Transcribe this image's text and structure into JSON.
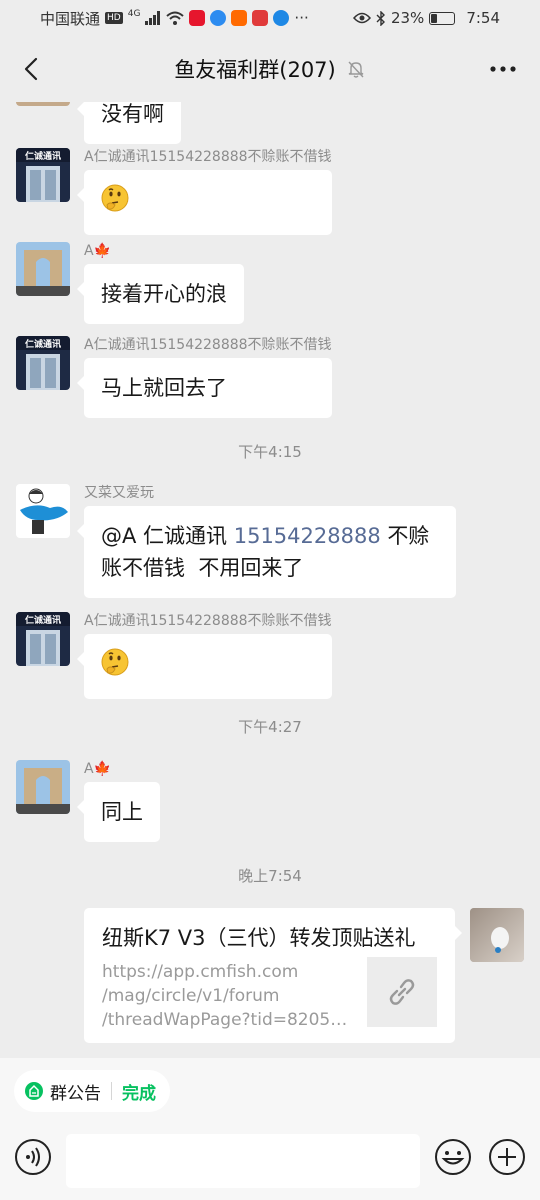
{
  "status_bar": {
    "carrier": "中国联通",
    "network_badge": "HD",
    "network_type": "4G",
    "battery": "23%",
    "battery_level": 0.23,
    "time": "7:54"
  },
  "header": {
    "title": "鱼友福利群(207)"
  },
  "messages": [
    {
      "text": "没有啊"
    },
    {
      "sender": "A仁诚通讯15154228888不赊账不借钱",
      "emoji": "thinking-face"
    },
    {
      "sender": "A🍁",
      "text": "接着开心的浪"
    },
    {
      "sender": "A仁诚通讯15154228888不赊账不借钱",
      "text": "马上就回去了"
    },
    {
      "sender": "又菜又爱玩",
      "line1_prefix": "@A 仁诚通讯 ",
      "line1_phone": "15154228888",
      "line1_suffix": " 不赊",
      "line2": "账不借钱  不用回来了"
    },
    {
      "sender": "A仁诚通讯15154228888不赊账不借钱",
      "emoji": "thinking-face"
    },
    {
      "sender": "A🍁",
      "text": "同上"
    }
  ],
  "times": [
    "下午4:15",
    "下午4:27",
    "晚上7:54"
  ],
  "shop_sign": "仁诚通讯",
  "link_card": {
    "title": "纽斯K7 V3（三代）转发顶贴送礼",
    "url_lines": [
      "https://app.cmfish.com",
      "/mag/circle/v1/forum",
      "/threadWapPage?tid=82059..."
    ],
    "icon": "link-icon"
  },
  "bottom": {
    "notice_label": "群公告",
    "done_label": "完成",
    "input_value": ""
  },
  "colors": {
    "background": "#ededed",
    "bubble": "#ffffff",
    "accent_green": "#07c160",
    "mention_blue": "#576b95"
  }
}
